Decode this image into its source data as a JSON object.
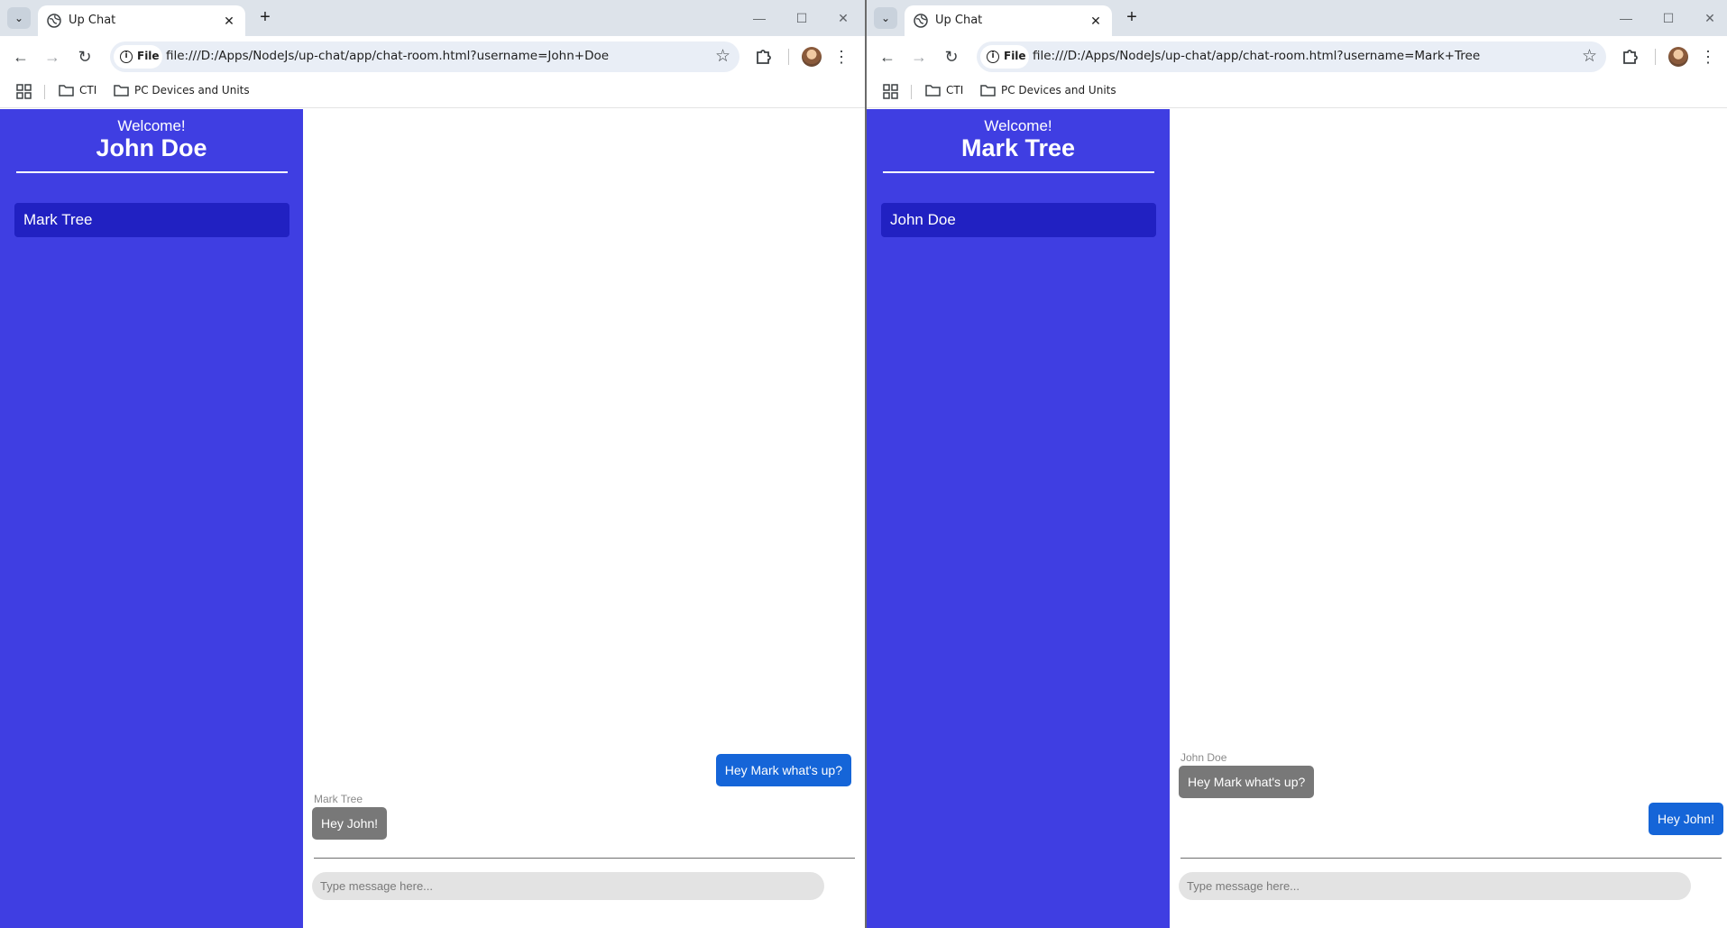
{
  "left_window": {
    "tab_title": "Up Chat",
    "file_chip": "File",
    "url": "file:///D:/Apps/NodeJs/up-chat/app/chat-room.html?username=John+Doe",
    "bookmarks": [
      "CTI",
      "PC Devices and Units"
    ],
    "sidebar": {
      "welcome": "Welcome!",
      "username": "John Doe",
      "contacts": [
        "Mark Tree"
      ]
    },
    "messages": [
      {
        "direction": "out",
        "text": "Hey Mark what's up?"
      },
      {
        "direction": "in",
        "sender": "Mark Tree",
        "text": "Hey John!"
      }
    ],
    "input_placeholder": "Type message here..."
  },
  "right_window": {
    "tab_title": "Up Chat",
    "file_chip": "File",
    "url": "file:///D:/Apps/NodeJs/up-chat/app/chat-room.html?username=Mark+Tree",
    "bookmarks": [
      "CTI",
      "PC Devices and Units"
    ],
    "sidebar": {
      "welcome": "Welcome!",
      "username": "Mark Tree",
      "contacts": [
        "John Doe"
      ]
    },
    "messages": [
      {
        "direction": "in",
        "sender": "John Doe",
        "text": "Hey Mark what's up?"
      },
      {
        "direction": "out",
        "text": "Hey John!"
      }
    ],
    "input_placeholder": "Type message here..."
  },
  "colors": {
    "sidebar": "#3f3ee2",
    "contact_selected": "#2121c2",
    "outgoing_bubble": "#1565d8",
    "incoming_bubble": "#787878",
    "browser_chrome": "#dde3ea"
  },
  "icons": [
    "tab-search-icon",
    "globe-icon",
    "close-icon",
    "new-tab-icon",
    "minimize-icon",
    "maximize-icon",
    "window-close-icon",
    "back-icon",
    "forward-icon",
    "reload-icon",
    "info-icon",
    "star-icon",
    "extensions-icon",
    "avatar",
    "menu-icon",
    "apps-icon",
    "folder-icon"
  ]
}
